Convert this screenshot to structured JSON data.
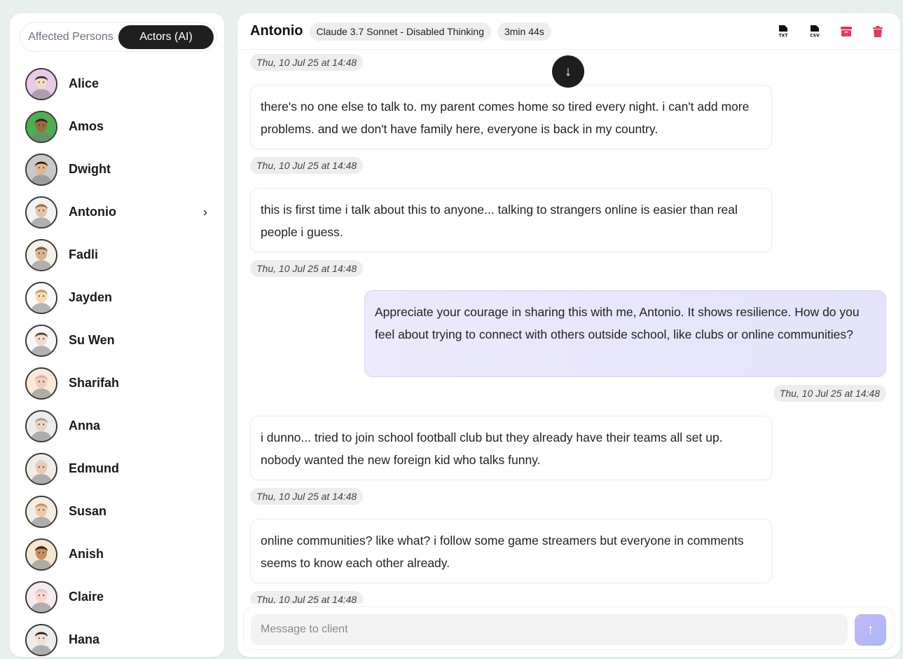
{
  "sidebar": {
    "toggle": {
      "affected_label": "Affected Persons",
      "actors_label": "Actors (AI)"
    },
    "actors": [
      {
        "name": "Alice",
        "skin": "#f4d9c6",
        "hair": "#2b2b2b",
        "bg": "#e8c9e8"
      },
      {
        "name": "Amos",
        "skin": "#9c6a3c",
        "hair": "#2b1d12",
        "bg": "#4caf50"
      },
      {
        "name": "Dwight",
        "skin": "#e2b58c",
        "hair": "#1d1d1d",
        "bg": "#c9c9c9"
      },
      {
        "name": "Antonio",
        "skin": "#e7c3a3",
        "hair": "#8a6a4a",
        "bg": "#f2f2f2"
      },
      {
        "name": "Fadli",
        "skin": "#d9b390",
        "hair": "#6b5a48",
        "bg": "#f6f1e8"
      },
      {
        "name": "Jayden",
        "skin": "#f5d9b3",
        "hair": "#c59a4a",
        "bg": "#fafafa"
      },
      {
        "name": "Su Wen",
        "skin": "#f3dccb",
        "hair": "#4a3a30",
        "bg": "#f7f7f7"
      },
      {
        "name": "Sharifah",
        "skin": "#f1cfb6",
        "hair": "#e7a3b9",
        "bg": "#f8e9d8"
      },
      {
        "name": "Anna",
        "skin": "#e9d4c2",
        "hair": "#9a9a9a",
        "bg": "#ececec"
      },
      {
        "name": "Edmund",
        "skin": "#ecc8ad",
        "hair": "#d8d8d8",
        "bg": "#f0ece6"
      },
      {
        "name": "Susan",
        "skin": "#f0c8a8",
        "hair": "#c48a5a",
        "bg": "#f4ede4"
      },
      {
        "name": "Anish",
        "skin": "#c78e5e",
        "hair": "#2a1d12",
        "bg": "#f3e7d1"
      },
      {
        "name": "Claire",
        "skin": "#f6d7cc",
        "hair": "#cfcfcf",
        "bg": "#f7ebef"
      },
      {
        "name": "Hana",
        "skin": "#f3dfd2",
        "hair": "#1f1f1f",
        "bg": "#ededed"
      }
    ],
    "selected_chevron": "›"
  },
  "header": {
    "title": "Antonio",
    "model_pill": "Claude 3.7 Sonnet - Disabled Thinking",
    "duration_pill": "3min 44s",
    "actions": {
      "txt_icon": "download-txt-icon",
      "csv_icon": "download-csv-icon",
      "archive_icon": "archive-icon",
      "delete_icon": "trash-icon",
      "danger_color": "#e8385f"
    }
  },
  "messages": [
    {
      "kind": "ts",
      "text": "Thu, 10 Jul 25 at 14:48"
    },
    {
      "kind": "client",
      "text": "there's no one else to talk to. my parent comes home so tired every night. i can't add more problems. and we don't have family here, everyone is back in my country."
    },
    {
      "kind": "ts",
      "text": "Thu, 10 Jul 25 at 14:48"
    },
    {
      "kind": "client",
      "text": "this is first time i talk about this to anyone... talking to strangers online is easier than real people i guess."
    },
    {
      "kind": "ts",
      "text": "Thu, 10 Jul 25 at 14:48"
    },
    {
      "kind": "user",
      "text": "Appreciate your courage in sharing this with me, Antonio. It shows resilience. How do you feel about trying to connect with others outside school, like clubs or online communities?"
    },
    {
      "kind": "ts",
      "text": "Thu, 10 Jul 25 at 14:48"
    },
    {
      "kind": "client",
      "text": "i dunno... tried to join school football club but they already have their teams all set up. nobody wanted the new foreign kid who talks funny."
    },
    {
      "kind": "ts",
      "text": "Thu, 10 Jul 25 at 14:48"
    },
    {
      "kind": "client",
      "text": "online communities? like what? i follow some game streamers but everyone in comments seems to know each other already."
    },
    {
      "kind": "ts",
      "text": "Thu, 10 Jul 25 at 14:48"
    }
  ],
  "scroll_down_glyph": "↓",
  "composer": {
    "placeholder": "Message to client",
    "send_glyph": "↑"
  }
}
